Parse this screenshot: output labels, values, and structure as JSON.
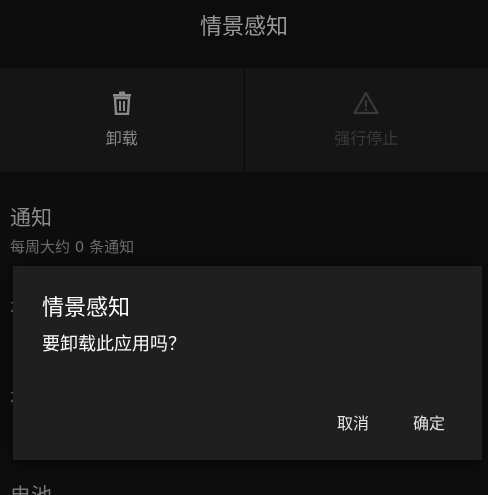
{
  "header": {
    "title": "情景感知"
  },
  "actions": [
    {
      "label": "卸载",
      "icon": "trash-icon",
      "enabled": true
    },
    {
      "label": "强行停止",
      "icon": "warning-triangle-icon",
      "enabled": false
    }
  ],
  "list": {
    "notifications": {
      "title": "通知",
      "subtitle": "每周大约 0 条通知"
    },
    "partial_items": [
      "存",
      "存",
      "存"
    ],
    "battery": "电池"
  },
  "dialog": {
    "title": "情景感知",
    "message": "要卸载此应用吗？",
    "cancel": "取消",
    "ok": "确定"
  }
}
